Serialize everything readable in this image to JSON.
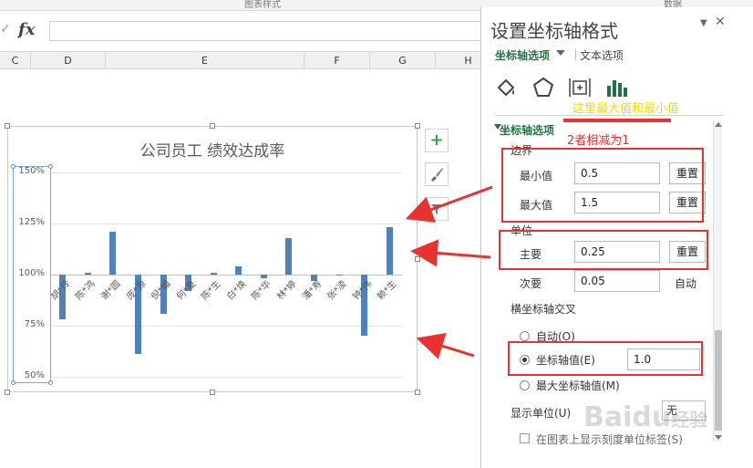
{
  "ribbon": {
    "group_left": "图表样式",
    "group_right": "数据"
  },
  "formula_bar": {
    "cancel_glyph": "✓",
    "fx_label": "fx",
    "value": ""
  },
  "columns": [
    "C",
    "D",
    "E",
    "F",
    "G",
    "H"
  ],
  "chart_data": {
    "type": "bar",
    "title": "公司员工 绩效达成率",
    "categories": [
      "胡*玲",
      "陈*鸿",
      "谢*圆",
      "庞*源",
      "倪*媚",
      "何*夏",
      "陈*生",
      "白*焕",
      "陈*华",
      "林*婷",
      "潘*寿",
      "张*凌",
      "钟*伟",
      "赖*生"
    ],
    "values": [
      0.78,
      1.01,
      1.21,
      0.61,
      0.81,
      0.92,
      1.01,
      1.04,
      0.98,
      1.18,
      0.97,
      1.0,
      0.7,
      1.23
    ],
    "ylim": [
      0.5,
      1.5
    ],
    "yticks": [
      "150%",
      "125%",
      "100%",
      "75%",
      "50%"
    ],
    "crosses_at": 1.0,
    "grid": true,
    "color": "#4f81bd"
  },
  "chart_buttons": {
    "add": "+",
    "brush": "brush",
    "filter": "filter"
  },
  "panel": {
    "title": "设置坐标轴格式",
    "tab_axis": "坐标轴选项",
    "tab_text": "文本选项",
    "section_title": "坐标轴选项",
    "bounds_label": "边界",
    "min_label": "最小值",
    "min_value": "0.5",
    "max_label": "最大值",
    "max_value": "1.5",
    "reset": "重置",
    "units_label": "单位",
    "major_label": "主要",
    "major_value": "0.25",
    "minor_label": "次要",
    "minor_value": "0.05",
    "auto_label": "自动",
    "cross_label": "横坐标轴交叉",
    "cross_auto": "自动(O)",
    "cross_value_label": "坐标轴值(E)",
    "cross_value": "1.0",
    "cross_max": "最大坐标轴值(M)",
    "display_units_label": "显示单位(U)",
    "display_units_value": "无",
    "show_units_label": "在图表上显示刻度单位标签(S)"
  },
  "annotations": {
    "yellow_text": "这里最大值和最小值",
    "red_text": "2者相减为1",
    "colors": {
      "red": "#e8322f",
      "yellow": "#f5e000"
    }
  },
  "watermark": {
    "brand": "Baidu",
    "suffix": "经验"
  }
}
